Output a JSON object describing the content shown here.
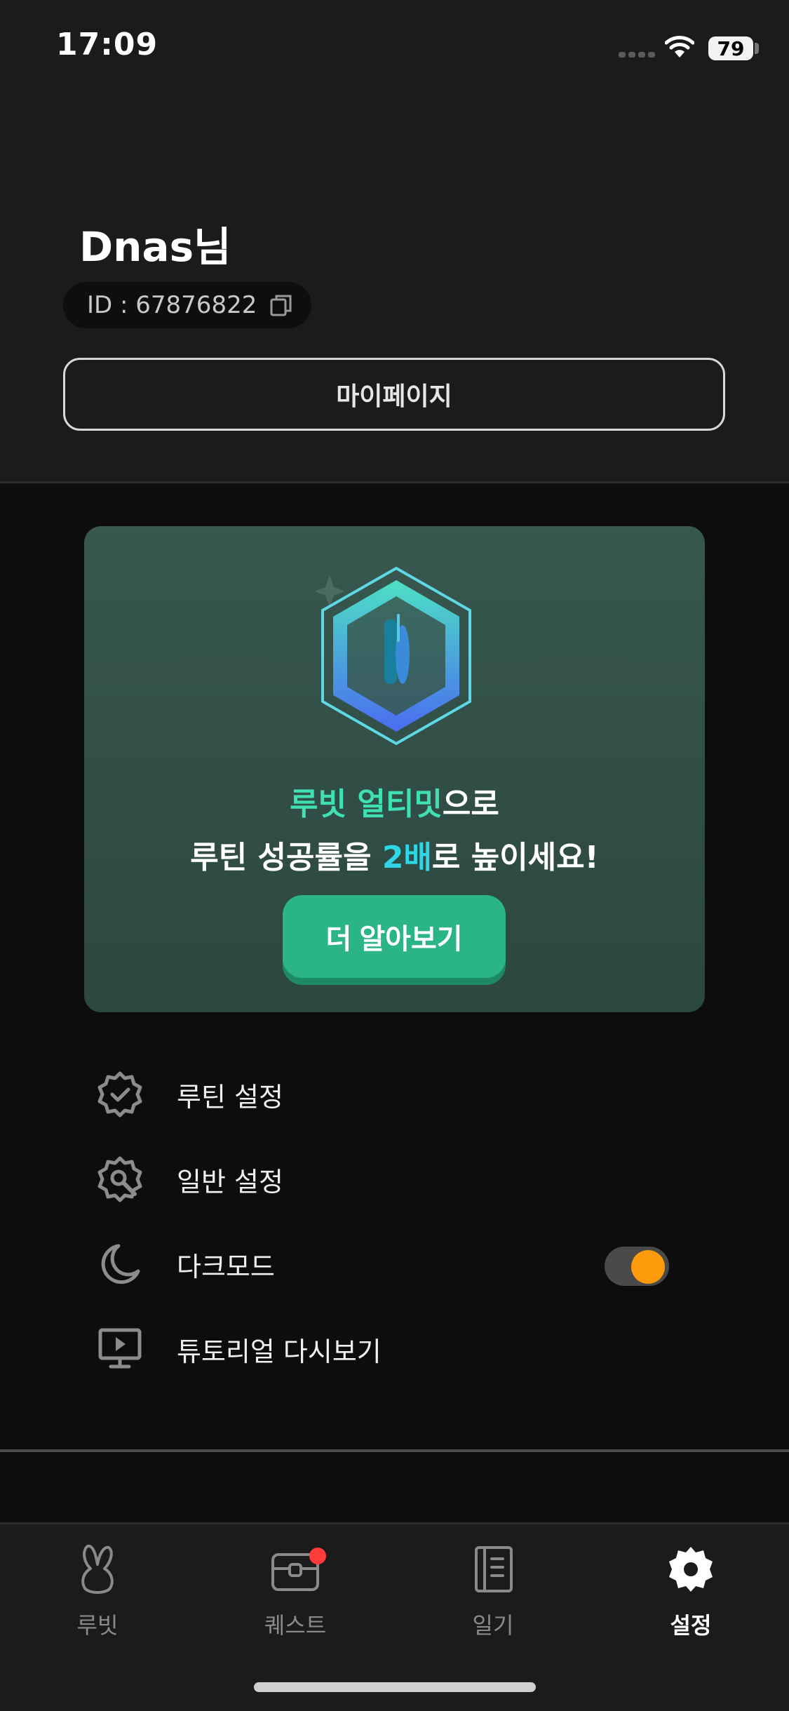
{
  "status_bar": {
    "time": "17:09",
    "battery": "79"
  },
  "profile": {
    "name": "Dnas님",
    "id_text": "ID : 67876822",
    "mypage_label": "마이페이지"
  },
  "promo": {
    "line1_highlight": "루빗 얼티밋",
    "line1_rest": "으로",
    "line2_prefix": "루틴 성공률을 ",
    "line2_highlight": "2배",
    "line2_suffix": "로 높이세요!",
    "button_label": "더 알아보기",
    "colors": {
      "green": "#3ee0b4",
      "cyan": "#2fd6e8",
      "button": "#2bb585"
    }
  },
  "menu": [
    {
      "label": "루틴 설정",
      "icon": "gear-check-icon"
    },
    {
      "label": "일반 설정",
      "icon": "gear-wrench-icon"
    },
    {
      "label": "다크모드",
      "icon": "moon-icon",
      "toggle_on": true
    },
    {
      "label": "튜토리얼 다시보기",
      "icon": "presentation-icon"
    }
  ],
  "tabs": [
    {
      "label": "루빗",
      "icon": "rabbit-icon",
      "active": false
    },
    {
      "label": "퀘스트",
      "icon": "chest-icon",
      "active": false,
      "badge": true
    },
    {
      "label": "일기",
      "icon": "diary-icon",
      "active": false
    },
    {
      "label": "설정",
      "icon": "gear-icon",
      "active": true
    }
  ],
  "accent": {
    "toggle": "#ff9c0d",
    "badge": "#ff3b3b"
  }
}
